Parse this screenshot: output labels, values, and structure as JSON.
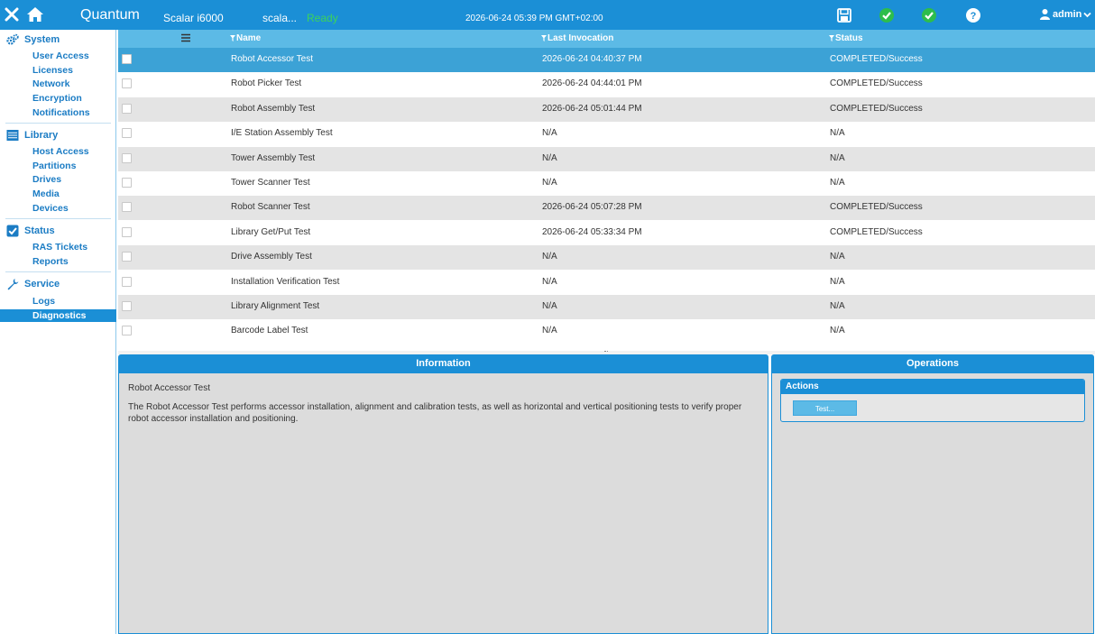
{
  "header": {
    "brand": "Quantum",
    "model": "Scalar i6000",
    "library_name": "scala...",
    "status": "Ready",
    "datetime": "2026-06-24 05:39 PM GMT+02:00",
    "user": "admin"
  },
  "sidebar": {
    "system": {
      "label": "System",
      "items": [
        "User Access",
        "Licenses",
        "Network",
        "Encryption",
        "Notifications"
      ]
    },
    "library": {
      "label": "Library",
      "items": [
        "Host Access",
        "Partitions",
        "Drives",
        "Media",
        "Devices"
      ]
    },
    "status": {
      "label": "Status",
      "items": [
        "RAS Tickets",
        "Reports"
      ]
    },
    "service": {
      "label": "Service",
      "items": [
        "Logs",
        "Diagnostics"
      ]
    }
  },
  "grid": {
    "columns": {
      "name": "Name",
      "last_invocation": "Last Invocation",
      "status": "Status"
    },
    "rows": [
      {
        "name": "Robot Accessor Test",
        "last": "2026-06-24 04:40:37 PM",
        "status": "COMPLETED/Success"
      },
      {
        "name": "Robot Picker Test",
        "last": "2026-06-24 04:44:01 PM",
        "status": "COMPLETED/Success"
      },
      {
        "name": "Robot Assembly Test",
        "last": "2026-06-24 05:01:44 PM",
        "status": "COMPLETED/Success"
      },
      {
        "name": "I/E Station Assembly Test",
        "last": "N/A",
        "status": "N/A"
      },
      {
        "name": "Tower Assembly Test",
        "last": "N/A",
        "status": "N/A"
      },
      {
        "name": "Tower Scanner Test",
        "last": "N/A",
        "status": "N/A"
      },
      {
        "name": "Robot Scanner Test",
        "last": "2026-06-24 05:07:28 PM",
        "status": "COMPLETED/Success"
      },
      {
        "name": "Library Get/Put Test",
        "last": "2026-06-24 05:33:34 PM",
        "status": "COMPLETED/Success"
      },
      {
        "name": "Drive Assembly Test",
        "last": "N/A",
        "status": "N/A"
      },
      {
        "name": "Installation Verification Test",
        "last": "N/A",
        "status": "N/A"
      },
      {
        "name": "Library Alignment Test",
        "last": "N/A",
        "status": "N/A"
      },
      {
        "name": "Barcode Label Test",
        "last": "N/A",
        "status": "N/A"
      }
    ]
  },
  "information": {
    "title": "Information",
    "test_name": "Robot Accessor Test",
    "description": "The Robot Accessor Test performs accessor installation, alignment and calibration tests, as well as horizontal and vertical positioning tests to verify proper robot accessor installation and positioning."
  },
  "operations": {
    "title": "Operations",
    "actions_label": "Actions",
    "test_button": "Test..."
  },
  "colors": {
    "accent": "#1b8fd6",
    "ready": "#3cd35a",
    "selected_row": "#3ca2d6"
  },
  "icons": [
    "close-icon",
    "home-icon",
    "save-icon",
    "check-icon",
    "help-icon",
    "user-icon",
    "gears-icon",
    "library-icon",
    "checkbox-icon",
    "wrench-icon",
    "filter-icon",
    "menu-icon"
  ]
}
